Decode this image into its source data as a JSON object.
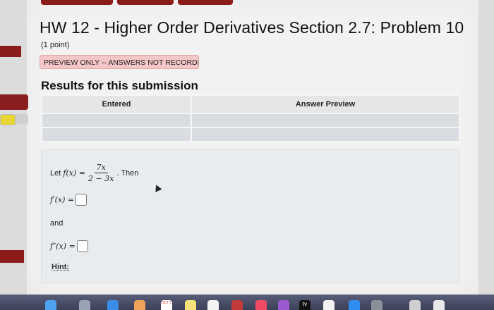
{
  "nav": {
    "buttons": [
      "",
      "",
      ""
    ]
  },
  "title": "HW 12 - Higher Order Derivatives Section 2.7: Problem 10",
  "points": "(1 point)",
  "preview_banner": "PREVIEW ONLY -- ANSWERS NOT RECORDED",
  "results": {
    "heading": "Results for this submission",
    "columns": [
      "Entered",
      "Answer Preview"
    ],
    "rows": [
      [
        "",
        ""
      ],
      [
        "",
        ""
      ]
    ]
  },
  "problem": {
    "let_prefix": "Let",
    "function_lhs": "f(x) =",
    "numerator": "7x",
    "denominator": "2 − 3x",
    "then_text": ". Then",
    "first_derivative_label": "f′(x) =",
    "and_text": "and",
    "second_derivative_label": "f″(x) =",
    "hint_text": "Hint:"
  },
  "colors": {
    "brand_red": "#8b1a1a",
    "banner_bg": "#f5c6c6",
    "table_cell": "#d9dde2"
  },
  "dock": {
    "icons": [
      "finder-icon",
      "launchpad-icon",
      "safari-icon",
      "photos-icon",
      "calendar-icon",
      "notes-icon",
      "music-icon",
      "podcasts-icon",
      "tv-icon",
      "news-icon",
      "appstore-icon",
      "settings-icon",
      "keyboard-icon",
      "preview-icon"
    ],
    "tv_label": "tv",
    "calendar_label": "OCT 1"
  }
}
